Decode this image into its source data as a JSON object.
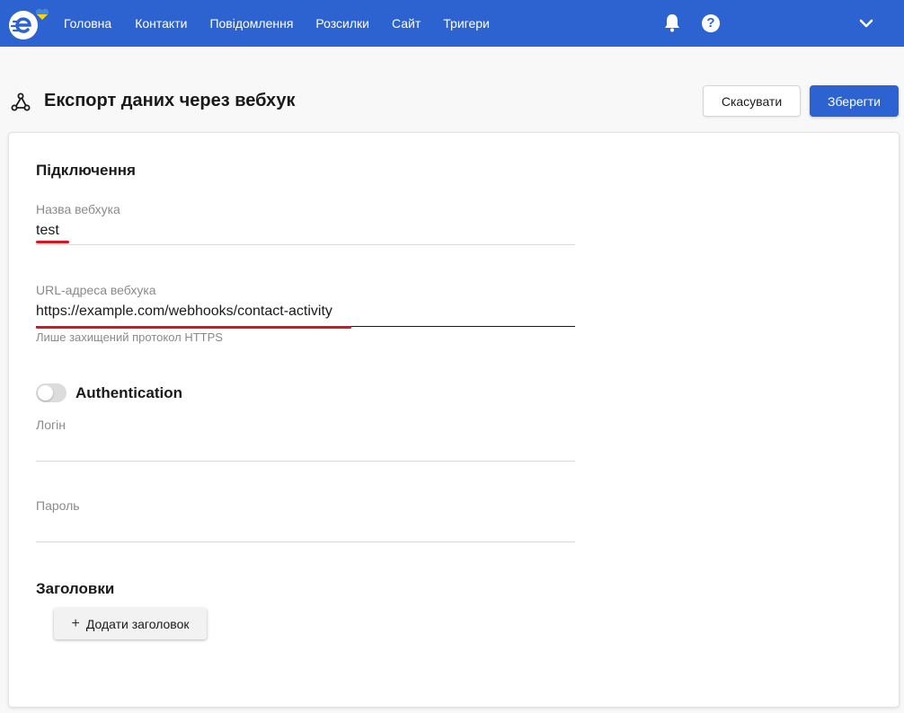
{
  "nav": {
    "items": [
      {
        "label": "Головна"
      },
      {
        "label": "Контакти"
      },
      {
        "label": "Повідомлення"
      },
      {
        "label": "Розсилки"
      },
      {
        "label": "Сайт"
      },
      {
        "label": "Тригери"
      }
    ],
    "help_label": "?",
    "icons": [
      "logo-icon",
      "bell-icon",
      "help-icon",
      "chevron-down-icon"
    ]
  },
  "header": {
    "title": "Експорт даних через вебхук",
    "cancel_label": "Скасувати",
    "save_label": "Зберегти"
  },
  "form": {
    "connection_title": "Підключення",
    "name_label": "Назва вебхука",
    "name_value": "test",
    "url_label": "URL-адреса вебхука",
    "url_value": "https://example.com/webhooks/contact-activity",
    "url_hint": "Лише захищений протокол HTTPS",
    "auth_label": "Authentication",
    "auth_enabled": false,
    "login_label": "Логін",
    "login_value": "",
    "password_label": "Пароль",
    "password_value": "",
    "headers_title": "Заголовки",
    "add_header_label": "Додати заголовок"
  },
  "colors": {
    "brand": "#2d63d0",
    "highlight": "#e0131a"
  }
}
